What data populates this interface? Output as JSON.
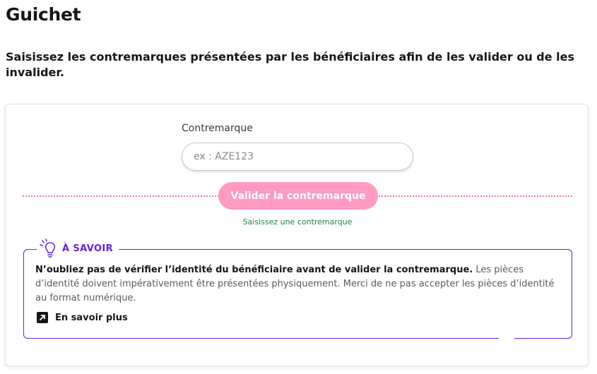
{
  "page": {
    "title": "Guichet",
    "intro": "Saisissez les contremarques présentées par les bénéficiaires afin de les valider ou de les invalider."
  },
  "form": {
    "label": "Contremarque",
    "input_value": "",
    "input_placeholder": "ex : AZE123",
    "submit_label": "Valider la contremarque",
    "helper_text": "Saisissez une contremarque"
  },
  "info": {
    "icon": "lightbulb-icon",
    "title": "À SAVOIR",
    "text_strong": "N’oubliez pas de vérifier l’identité du bénéficiaire avant de valider la contremarque.",
    "text_rest": " Les pièces d’identité doivent impérativement être présentées physiquement. Merci de ne pas accepter les pièces d’identité au format numérique.",
    "link_icon": "external-link-icon",
    "link_label": "En savoir plus"
  },
  "colors": {
    "text": "#161617",
    "button_disabled": "#ff9ac1",
    "separator": "#c4115b",
    "success": "#20804f",
    "info_accent": "#6123df"
  }
}
